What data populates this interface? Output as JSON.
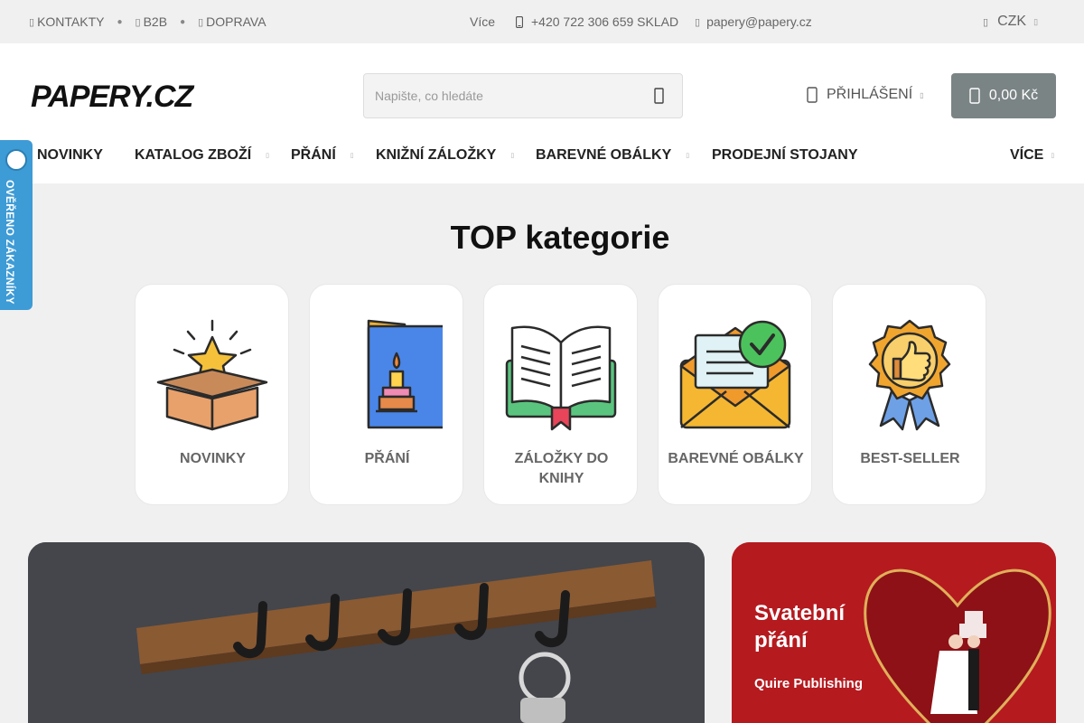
{
  "topbar": {
    "links": [
      {
        "icon": "contact-icon",
        "label": "KONTAKTY"
      },
      {
        "icon": "b2b-icon",
        "label": "B2B"
      },
      {
        "icon": "delivery-icon",
        "label": "DOPRAVA"
      }
    ],
    "more_label": "Více",
    "phone": "+420 722 306 659 SKLAD",
    "email": "papery@papery.cz",
    "currency": "CZK"
  },
  "header": {
    "logo_text": "PAPERY.CZ",
    "search_placeholder": "Napište, co hledáte",
    "login_label": "PŘIHLÁŠENÍ",
    "cart_total": "0,00 Kč"
  },
  "nav": {
    "items": [
      {
        "label": "NOVINKY",
        "has_submenu": false
      },
      {
        "label": "KATALOG ZBOŽÍ",
        "has_submenu": true
      },
      {
        "label": "PŘÁNÍ",
        "has_submenu": true
      },
      {
        "label": "KNIŽNÍ ZÁLOŽKY",
        "has_submenu": true
      },
      {
        "label": "BAREVNÉ OBÁLKY",
        "has_submenu": true
      },
      {
        "label": "PRODEJNÍ STOJANY",
        "has_submenu": false
      }
    ],
    "more_label": "VÍCE"
  },
  "badge": {
    "text": "OVĚŘENO ZÁKAZNÍKY"
  },
  "categories": {
    "title": "TOP kategorie",
    "items": [
      {
        "label": "NOVINKY",
        "icon": "open-box-star-icon"
      },
      {
        "label": "PŘÁNÍ",
        "icon": "birthday-card-icon"
      },
      {
        "label": "ZÁLOŽKY DO KNIHY",
        "icon": "open-book-bookmark-icon"
      },
      {
        "label": "BAREVNÉ OBÁLKY",
        "icon": "envelope-check-icon"
      },
      {
        "label": "BEST-SELLER",
        "icon": "thumbs-up-award-icon"
      }
    ]
  },
  "banners": {
    "right": {
      "title_line1": "Svatební",
      "title_line2": "přání",
      "publisher": "Quire Publishing"
    }
  },
  "colors": {
    "cart_bg": "#7b8485",
    "badge_bg": "#3d9bd6",
    "banner_red": "#b51a1f",
    "page_bg": "#f0f0f0"
  }
}
